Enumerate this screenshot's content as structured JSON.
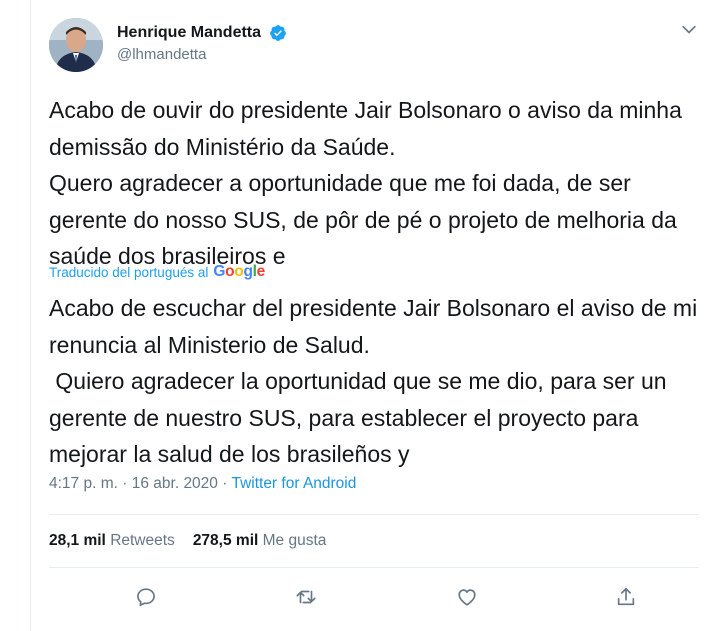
{
  "user": {
    "name": "Henrique Mandetta",
    "handle": "@lhmandetta"
  },
  "tweet": {
    "text": "Acabo de ouvir do presidente Jair Bolsonaro o aviso da minha demissão do Ministério da Saúde.\nQuero agradecer a oportunidade que me foi dada, de ser gerente do nosso SUS, de pôr de pé o projeto de melhoria da saúde dos brasileiros e",
    "translated_label": "Traducido del portugués al",
    "translator": "Google",
    "translation": "Acabo de escuchar del presidente Jair Bolsonaro el aviso de mi renuncia al Ministerio de Salud.\n Quiero agradecer la oportunidad que se me dio, para ser un gerente de nuestro SUS, para establecer el proyecto para mejorar la salud de los brasileños y"
  },
  "meta": {
    "time": "4:17 p. m.",
    "separator": "·",
    "date": "16 abr. 2020",
    "source": "Twitter for Android"
  },
  "stats": {
    "retweets_count": "28,1 mil",
    "retweets_label": "Retweets",
    "likes_count": "278,5 mil",
    "likes_label": "Me gusta"
  },
  "colors": {
    "link": "#1b95e0",
    "muted": "#657786",
    "verified": "#1da1f2"
  },
  "icons": [
    "verified-badge-icon",
    "chevron-down-icon",
    "reply-icon",
    "retweet-icon",
    "like-icon",
    "share-icon"
  ]
}
